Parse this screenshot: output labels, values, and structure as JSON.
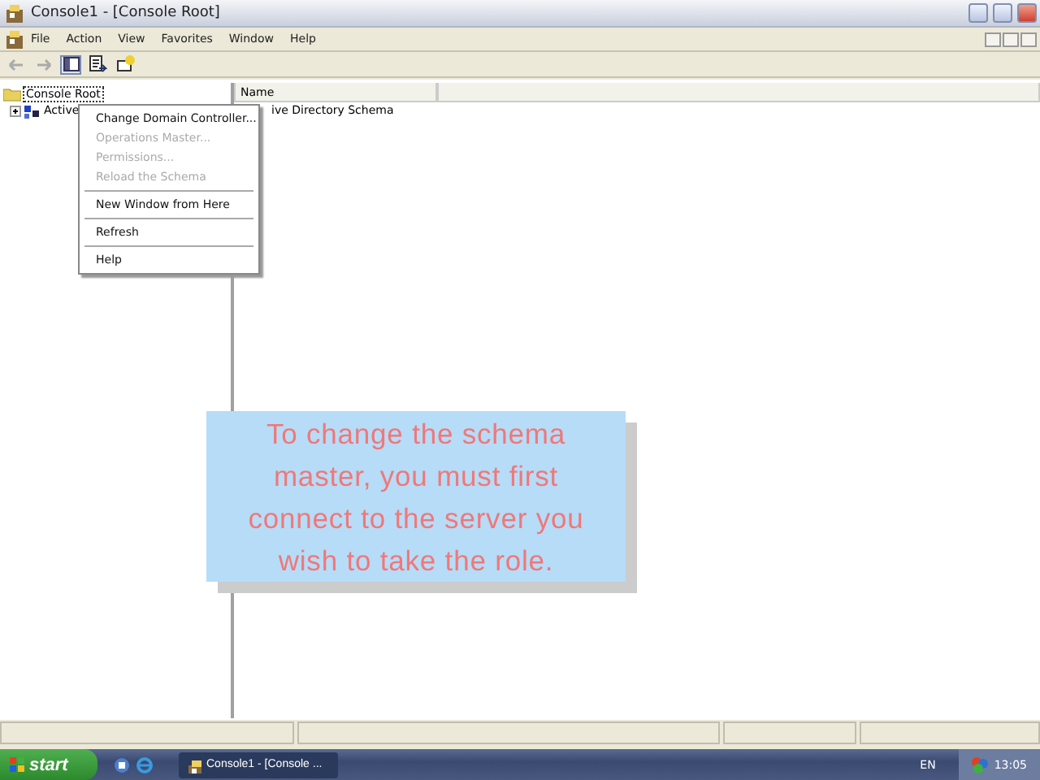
{
  "window": {
    "title": "Console1 - [Console Root]"
  },
  "menu_bar": [
    "File",
    "Action",
    "View",
    "Favorites",
    "Window",
    "Help"
  ],
  "tree": [
    {
      "label": "Console Root",
      "selected": true,
      "children": [
        {
          "label": "Active",
          "selected": false,
          "expanded": false
        }
      ]
    }
  ],
  "list": {
    "columns": [
      "Name"
    ],
    "rows": [
      "ive Directory Schema"
    ]
  },
  "context_menu": [
    {
      "kind": "item",
      "label": "Change Domain Controller...",
      "disabled": false
    },
    {
      "kind": "item",
      "label": "Operations Master...",
      "disabled": true
    },
    {
      "kind": "item",
      "label": "Permissions...",
      "disabled": true
    },
    {
      "kind": "item",
      "label": "Reload the Schema",
      "disabled": true
    },
    {
      "kind": "separator"
    },
    {
      "kind": "item",
      "label": "New Window from Here",
      "disabled": false
    },
    {
      "kind": "separator"
    },
    {
      "kind": "item",
      "label": "Refresh",
      "disabled": false
    },
    {
      "kind": "separator"
    },
    {
      "kind": "item",
      "label": "Help",
      "disabled": false
    }
  ],
  "caption": "To change the schema master, you must first connect to the server you wish to take the role.",
  "taskbar": {
    "start": "start",
    "tasks": [
      {
        "label": "Console1 - [Console ...",
        "selected": true
      }
    ],
    "language": "EN",
    "clock": "13:05"
  }
}
